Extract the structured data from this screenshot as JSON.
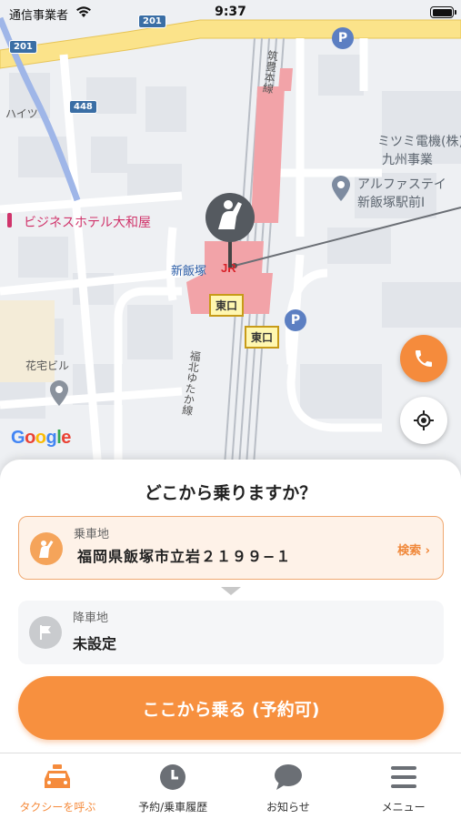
{
  "status_bar": {
    "carrier": "通信事業者",
    "time": "9:37"
  },
  "map": {
    "labels": {
      "station": "新飯塚",
      "hotel": "ビジネスホテル大和屋",
      "mitsumi_1": "ミツミ電機(株)",
      "mitsumi_2": "九州事業",
      "alpha_1": "アルファステイ",
      "alpha_2": "新飯塚駅前Ⅰ",
      "hanataku": "花宅ビル",
      "haitsu": "ハイツ",
      "chikuho": "筑豊本線",
      "fukuhoku": "福北ゆたか線",
      "east_exit_1": "東口",
      "east_exit_2": "東口",
      "parking_1": "P",
      "parking_2": "P"
    },
    "shields": {
      "route_201_a": "201",
      "route_201_b": "201",
      "route_448": "448"
    },
    "google": [
      "G",
      "o",
      "o",
      "g",
      "l",
      "e"
    ]
  },
  "sheet": {
    "title": "どこから乗りますか？",
    "pickup": {
      "label": "乗車地",
      "value": "福岡県飯塚市立岩２１９９−１",
      "search": "検索 ›"
    },
    "dropoff": {
      "label": "降車地",
      "value": "未設定"
    },
    "cta": "ここから乗る (予約可)"
  },
  "tabs": [
    {
      "label": "タクシーを呼ぶ",
      "icon": "taxi-icon",
      "active": true
    },
    {
      "label": "予約/乗車履歴",
      "icon": "clock-icon",
      "active": false
    },
    {
      "label": "お知らせ",
      "icon": "chat-bubble-icon",
      "active": false
    },
    {
      "label": "メニュー",
      "icon": "hamburger-menu-icon",
      "active": false
    }
  ],
  "colors": {
    "accent": "#f7903f",
    "pickup_bg": "#fef2e8",
    "station": "#f29aa1"
  }
}
